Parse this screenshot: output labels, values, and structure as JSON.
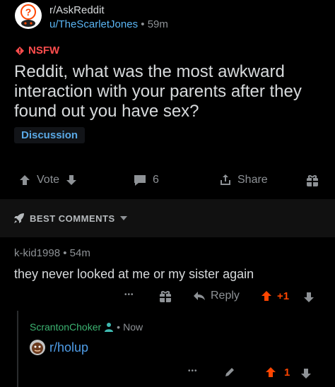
{
  "post": {
    "subreddit": "r/AskReddit",
    "author": "u/TheScarletJones",
    "separator": "•",
    "age": "59m",
    "nsfw_label": "NSFW",
    "title": "Reddit, what was the most awkward interaction with your parents after they found out you have sex?",
    "flair": "Discussion",
    "vote_label": "Vote",
    "comment_count": "6",
    "share_label": "Share"
  },
  "sort": {
    "label": "BEST COMMENTS"
  },
  "comment": {
    "author": "k-kid1998",
    "separator": "•",
    "age": "54m",
    "body": "they never looked at me or my sister again",
    "more": "•••",
    "reply_label": "Reply",
    "score": "+1"
  },
  "reply": {
    "author": "ScrantonChoker",
    "separator": "•",
    "age": "Now",
    "link": "r/holup",
    "more": "•••",
    "score": "1"
  },
  "colors": {
    "background": "#000000",
    "nsfw": "#ff4d4d",
    "upvote": "#ff4500",
    "link": "#4f9de8",
    "op_user": "#3cb371"
  },
  "icons": [
    "askreddit-avatar",
    "nsfw-diamond-icon",
    "upvote-icon",
    "downvote-icon",
    "comment-icon",
    "share-icon",
    "award-icon",
    "rocket-icon",
    "chevron-down-icon",
    "reply-icon",
    "person-icon",
    "edit-icon",
    "subreddit-avatar"
  ]
}
